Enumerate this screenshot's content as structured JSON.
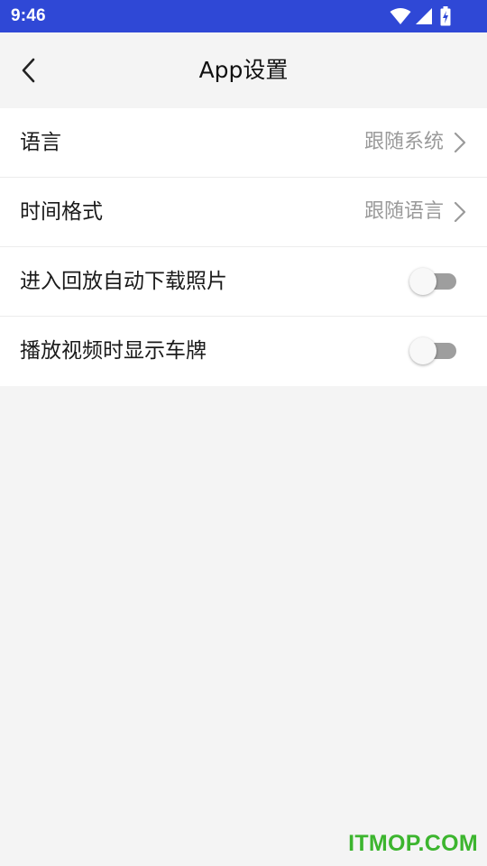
{
  "status_bar": {
    "time": "9:46",
    "icons": [
      "wifi-icon",
      "cell-signal-icon",
      "battery-charging-icon"
    ],
    "color": "#2f48d6"
  },
  "header": {
    "title": "App设置",
    "back_icon": "chevron-left-icon"
  },
  "settings": {
    "language": {
      "label": "语言",
      "value": "跟随系统"
    },
    "time_format": {
      "label": "时间格式",
      "value": "跟随语言"
    },
    "auto_download_photos": {
      "label": "进入回放自动下载照片",
      "enabled": false
    },
    "show_plate": {
      "label": "播放视频时显示车牌",
      "enabled": false
    }
  },
  "watermark": {
    "text": "ITMOP.COM",
    "color": "#3cb52e"
  }
}
